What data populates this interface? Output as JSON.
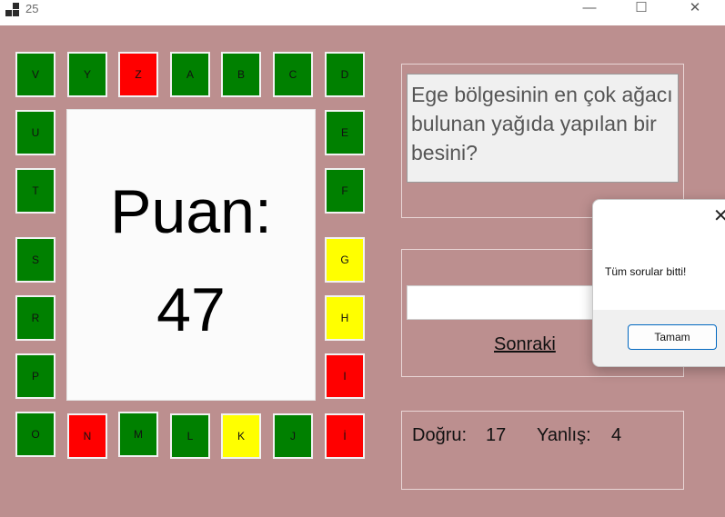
{
  "window": {
    "title": "25",
    "minimize": "—",
    "maximize": "☐",
    "close": "✕"
  },
  "colors": {
    "green": "#008000",
    "red": "#ff0000",
    "yellow": "#ffff00",
    "background": "#bc8f8f"
  },
  "letters": [
    {
      "letter": "V",
      "status": "green"
    },
    {
      "letter": "Y",
      "status": "green"
    },
    {
      "letter": "Z",
      "status": "red"
    },
    {
      "letter": "A",
      "status": "green"
    },
    {
      "letter": "B",
      "status": "green"
    },
    {
      "letter": "C",
      "status": "green"
    },
    {
      "letter": "D",
      "status": "green"
    },
    {
      "letter": "U",
      "status": "green"
    },
    {
      "letter": "E",
      "status": "green"
    },
    {
      "letter": "T",
      "status": "green"
    },
    {
      "letter": "F",
      "status": "green"
    },
    {
      "letter": "S",
      "status": "green"
    },
    {
      "letter": "G",
      "status": "yellow"
    },
    {
      "letter": "R",
      "status": "green"
    },
    {
      "letter": "H",
      "status": "yellow"
    },
    {
      "letter": "P",
      "status": "green"
    },
    {
      "letter": "I",
      "status": "red"
    },
    {
      "letter": "O",
      "status": "green"
    },
    {
      "letter": "N",
      "status": "red"
    },
    {
      "letter": "M",
      "status": "green"
    },
    {
      "letter": "L",
      "status": "green"
    },
    {
      "letter": "K",
      "status": "yellow"
    },
    {
      "letter": "J",
      "status": "green"
    },
    {
      "letter": "İ",
      "status": "red"
    }
  ],
  "score": {
    "label": "Puan:",
    "value": "47"
  },
  "question": {
    "text": "Ege bölgesinin en çok ağacı bulunan yağıda yapılan bir besini?"
  },
  "answer": {
    "value": ""
  },
  "next_label": "Sonraki",
  "stats": {
    "correct_label": "Doğru:",
    "correct_value": "17",
    "wrong_label": "Yanlış:",
    "wrong_value": "4"
  },
  "dialog": {
    "close": "✕",
    "message": "Tüm sorular bitti!",
    "ok_label": "Tamam"
  }
}
